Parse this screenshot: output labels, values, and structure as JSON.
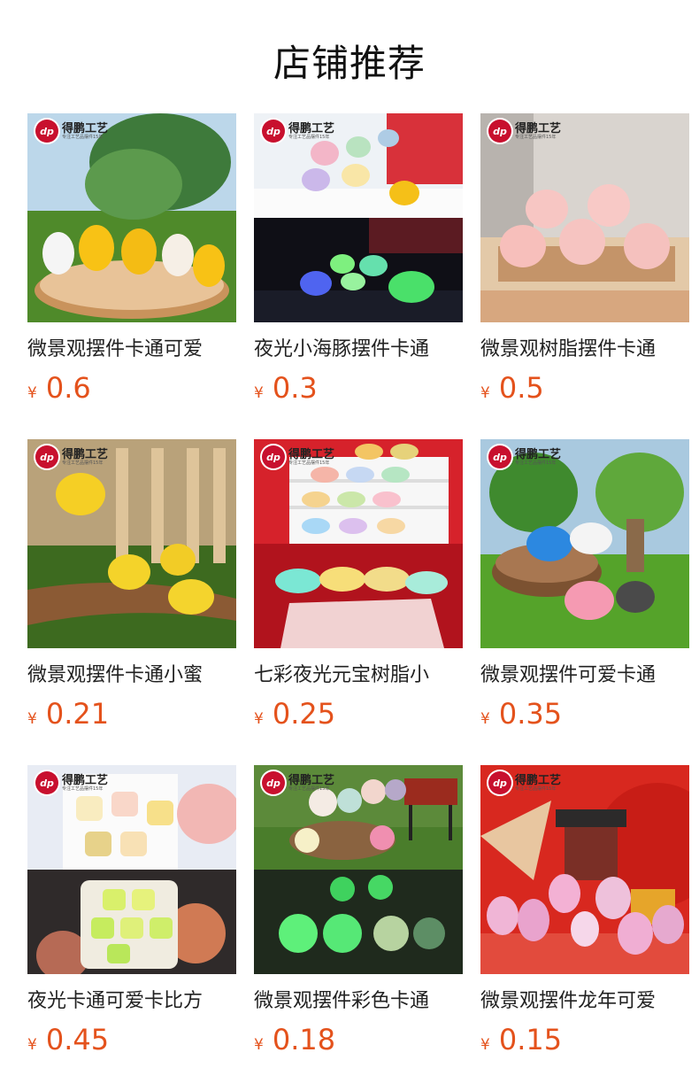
{
  "header": {
    "title": "店铺推荐"
  },
  "brand": {
    "logo_mark": "dp",
    "logo_name": "得鹏工艺",
    "logo_tagline": "专注工艺品摆件15年"
  },
  "products": [
    {
      "name": "微景观摆件卡通可爱",
      "currency": "¥",
      "price": "0.6",
      "image": "cartoon-ducks-on-wood"
    },
    {
      "name": "夜光小海豚摆件卡通",
      "currency": "¥",
      "price": "0.3",
      "image": "glow-dolphins"
    },
    {
      "name": "微景观树脂摆件卡通",
      "currency": "¥",
      "price": "0.5",
      "image": "pink-pigs"
    },
    {
      "name": "微景观摆件卡通小蜜",
      "currency": "¥",
      "price": "0.21",
      "image": "bees-on-log"
    },
    {
      "name": "七彩夜光元宝树脂小",
      "currency": "¥",
      "price": "0.25",
      "image": "colorful-ingots"
    },
    {
      "name": "微景观摆件可爱卡通",
      "currency": "¥",
      "price": "0.35",
      "image": "whales-on-stump"
    },
    {
      "name": "夜光卡通可爱卡比方",
      "currency": "¥",
      "price": "0.45",
      "image": "glow-cartoon-cubes"
    },
    {
      "name": "微景观摆件彩色卡通",
      "currency": "¥",
      "price": "0.18",
      "image": "glow-figurines"
    },
    {
      "name": "微景观摆件龙年可爱",
      "currency": "¥",
      "price": "0.15",
      "image": "pink-dragons"
    }
  ]
}
